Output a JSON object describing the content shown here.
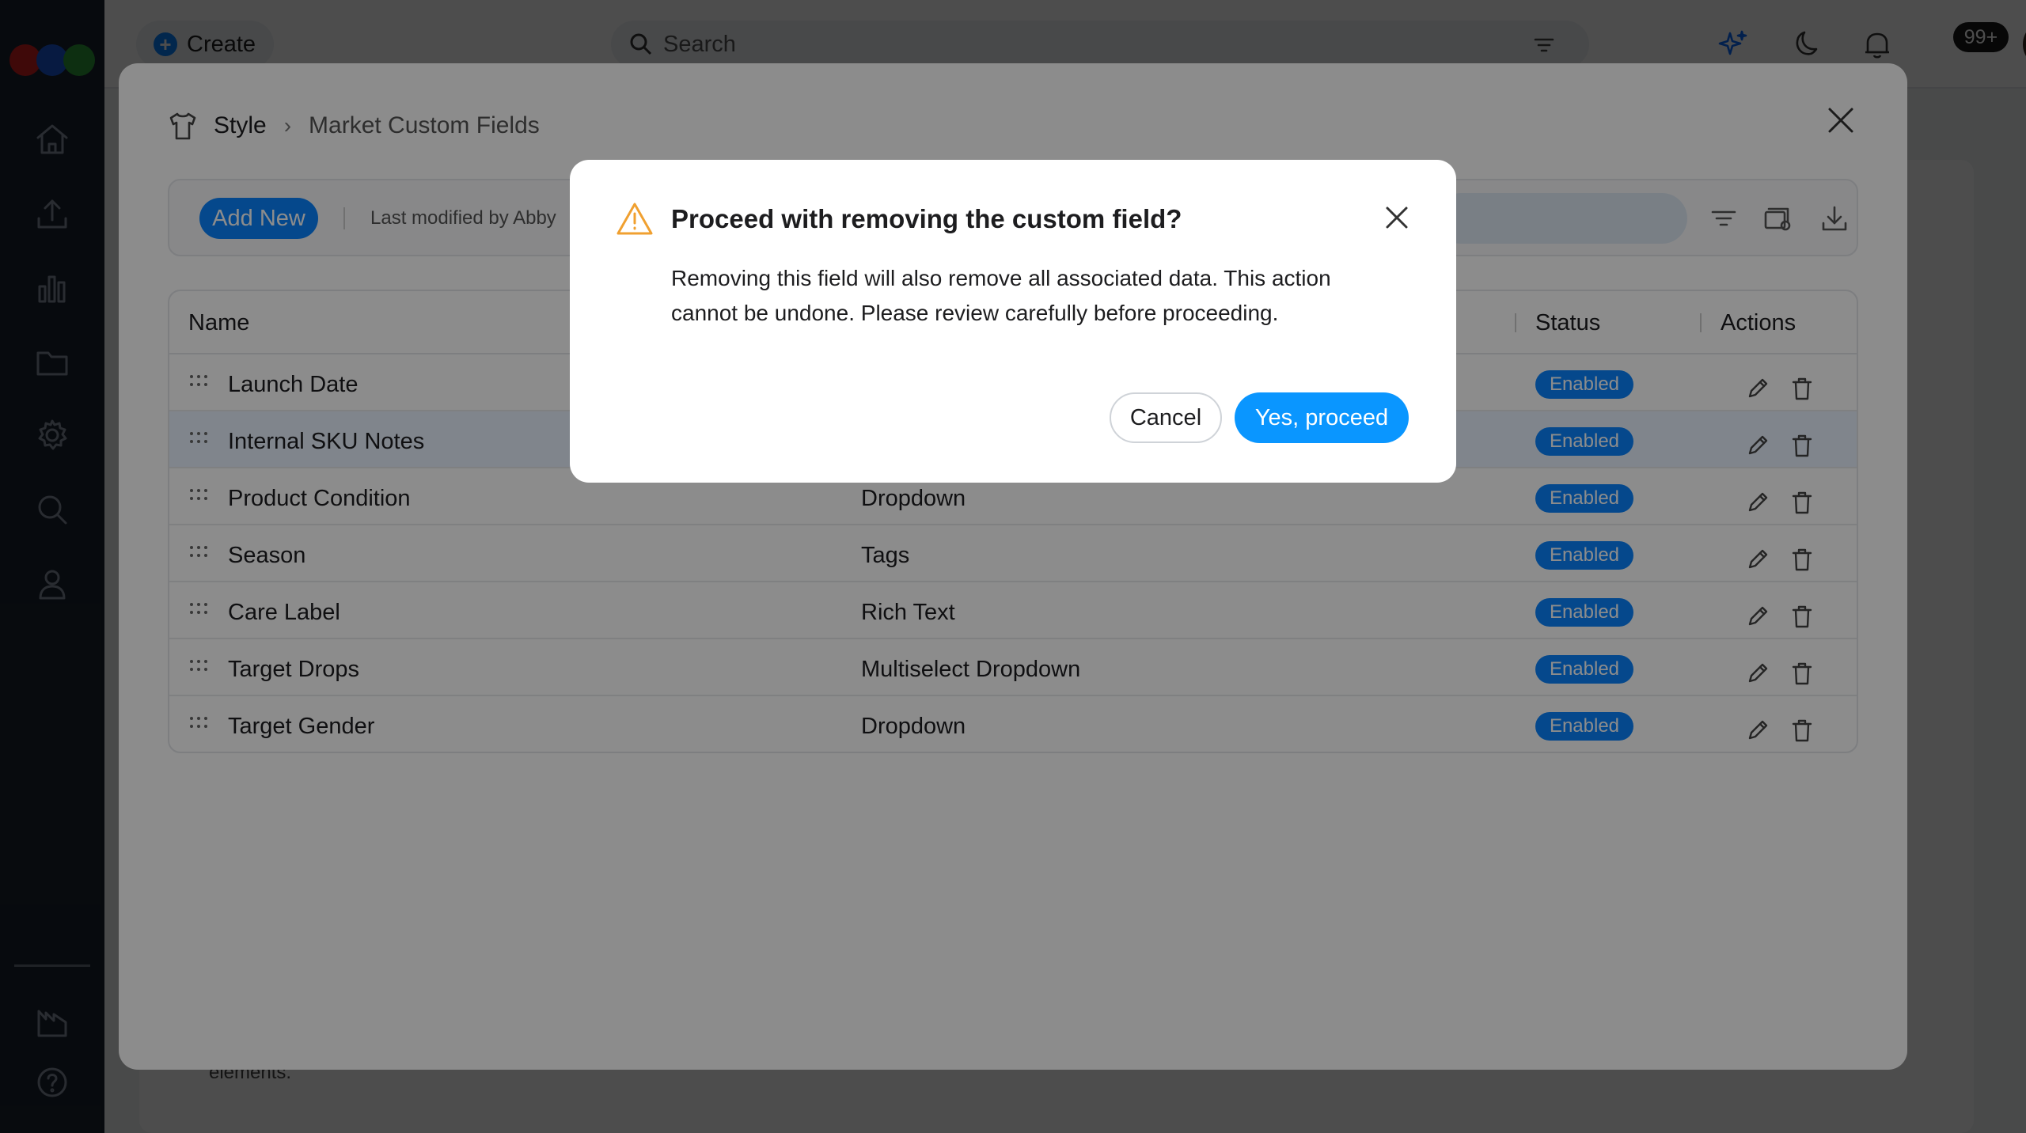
{
  "topbar": {
    "create_label": "Create",
    "search_placeholder": "Search",
    "notification_count": "99+"
  },
  "background": {
    "note_fragment": "elements."
  },
  "modal": {
    "breadcrumb": {
      "section": "Style",
      "page": "Market Custom Fields"
    },
    "toolbar": {
      "add_new_label": "Add New",
      "last_modified": "Last modified by Abby"
    },
    "table": {
      "headers": {
        "name": "Name",
        "status": "Status",
        "actions": "Actions"
      },
      "rows": [
        {
          "name": "Launch Date",
          "type": "",
          "status": "Enabled"
        },
        {
          "name": "Internal SKU Notes",
          "type": "",
          "status": "Enabled"
        },
        {
          "name": "Product Condition",
          "type": "Dropdown",
          "status": "Enabled"
        },
        {
          "name": "Season",
          "type": "Tags",
          "status": "Enabled"
        },
        {
          "name": "Care Label",
          "type": "Rich Text",
          "status": "Enabled"
        },
        {
          "name": "Target Drops",
          "type": "Multiselect Dropdown",
          "status": "Enabled"
        },
        {
          "name": "Target Gender",
          "type": "Dropdown",
          "status": "Enabled"
        }
      ]
    }
  },
  "alert": {
    "title": "Proceed with removing the custom field?",
    "body": "Removing this field will also remove all associated data. This action cannot be undone. Please review carefully before proceeding.",
    "cancel_label": "Cancel",
    "confirm_label": "Yes, proceed"
  },
  "colors": {
    "accent": "#0a84ff",
    "sidebar": "#1b2330",
    "warning": "#f0a030"
  }
}
